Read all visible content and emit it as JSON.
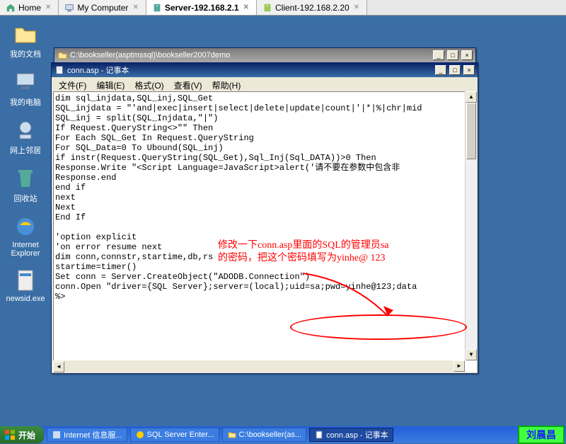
{
  "tabs": [
    {
      "label": "Home",
      "icon": "home"
    },
    {
      "label": "My Computer",
      "icon": "computer"
    },
    {
      "label": "Server-192.168.2.1",
      "icon": "server",
      "active": true
    },
    {
      "label": "Client-192.168.2.20",
      "icon": "client"
    }
  ],
  "desktop_icons": [
    {
      "label": "我的文档",
      "kind": "folder"
    },
    {
      "label": "我的电脑",
      "kind": "computer"
    },
    {
      "label": "网上邻居",
      "kind": "network"
    },
    {
      "label": "回收站",
      "kind": "recycle"
    },
    {
      "label": "Internet Explorer",
      "kind": "ie"
    },
    {
      "label": "newsid.exe",
      "kind": "exe"
    }
  ],
  "back_window": {
    "title": "C:\\bookseller(asptmssql)\\bookseller2007demo"
  },
  "notepad": {
    "title": "conn.asp - 记事本",
    "menus": {
      "file": "文件(F)",
      "edit": "编辑(E)",
      "format": "格式(O)",
      "view": "查看(V)",
      "help": "帮助(H)"
    },
    "content": "dim sql_injdata,SQL_inj,SQL_Get\nSQL_injdata = \"'and|exec|insert|select|delete|update|count|'|*|%|chr|mid\nSQL_inj = split(SQL_Injdata,\"|\")\nIf Request.QueryString<>\"\" Then\nFor Each SQL_Get In Request.QueryString\nFor SQL_Data=0 To Ubound(SQL_inj)\nif instr(Request.QueryString(SQL_Get),Sql_Inj(Sql_DATA))>0 Then\nResponse.Write \"<Script Language=JavaScript>alert('请不要在参数中包含非\nResponse.end\nend if\nnext\nNext\nEnd If\n\n'option explicit\n'on error resume next\ndim conn,connstr,startime,db,rs\nstartime=timer()\nSet conn = Server.CreateObject(\"ADODB.Connection\")\nconn.Open \"driver={SQL Server};server=(local);uid=sa;pwd=yinhe@123;data\n%>"
  },
  "annotation": {
    "line1": "修改一下conn.asp里面的SQL的管理员sa",
    "line2": "的密码，把这个密码填写为yinhe@ 123"
  },
  "taskbar": {
    "start": "开始",
    "buttons": [
      {
        "label": "Internet 信息服..."
      },
      {
        "label": "SQL Server Enter..."
      },
      {
        "label": "C:\\bookseller(as..."
      },
      {
        "label": "conn.asp - 记事本",
        "active": true
      }
    ],
    "watermark": "刘晨昌"
  },
  "window_buttons": {
    "min": "_",
    "max": "□",
    "close": "×"
  }
}
